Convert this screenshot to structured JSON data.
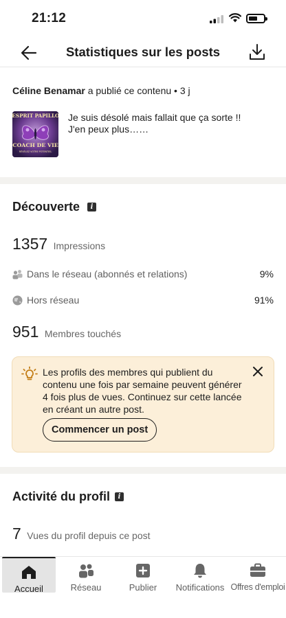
{
  "status_bar": {
    "time": "21:12"
  },
  "header": {
    "title": "Statistiques sur les posts",
    "back_icon": "arrow-left-icon",
    "download_icon": "download-icon"
  },
  "post": {
    "author": "Céline Benamar",
    "action_text": "a publié ce contenu",
    "separator": "•",
    "age": "3 j",
    "thumbnail": {
      "top_text": "L'ESPRIT PAPILLON",
      "bottom_text": "COACH DE VIE",
      "small_text": "RÉVÉLEZ VOTRE POTENTIEL"
    },
    "text_line1": "Je suis désolé mais fallait que ça sorte !!",
    "text_line2": "J'en peux plus……"
  },
  "discovery": {
    "title": "Découverte",
    "impressions_value": "1357",
    "impressions_label": "Impressions",
    "network_label": "Dans le réseau (abonnés et relations)",
    "network_value": "9%",
    "out_network_label": "Hors réseau",
    "out_network_value": "91%",
    "members_value": "951",
    "members_label": "Membres touchés"
  },
  "tip": {
    "text": "Les profils des membres qui publient du contenu une fois par semaine peuvent générer 4 fois plus de vues. Continuez sur cette lancée en créant un autre post.",
    "button_label": "Commencer un post",
    "icon": "lightbulb-icon"
  },
  "profile_activity": {
    "title": "Activité du profil",
    "views_value": "7",
    "views_label": "Vues du profil depuis ce post"
  },
  "bottom_nav": {
    "items": [
      {
        "label": "Accueil",
        "icon": "home-icon"
      },
      {
        "label": "Réseau",
        "icon": "people-icon"
      },
      {
        "label": "Publier",
        "icon": "plus-square-icon"
      },
      {
        "label": "Notifications",
        "icon": "bell-icon"
      },
      {
        "label": "Offres d'emploi",
        "icon": "briefcase-icon"
      }
    ]
  },
  "colors": {
    "tip_background": "#fcefd9",
    "section_divider": "#f3f2ef",
    "tip_icon": "#c37d16"
  }
}
